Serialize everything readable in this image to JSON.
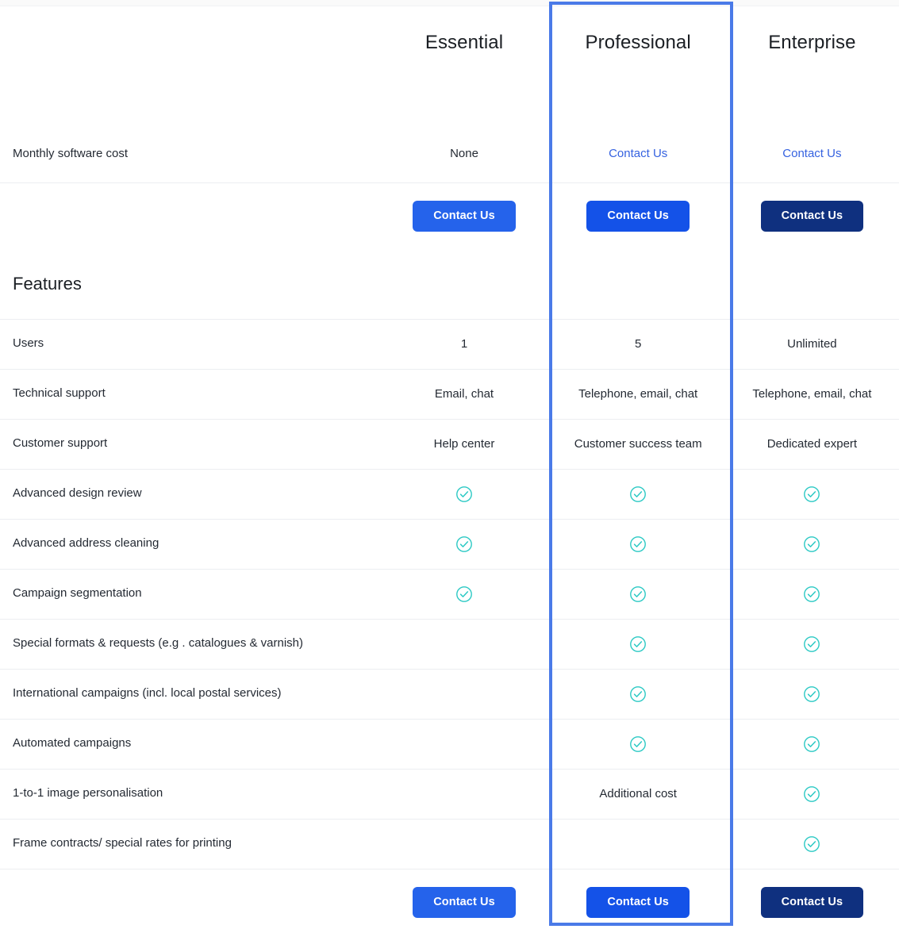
{
  "accent": {
    "highlight_border": "#4a7ae8",
    "link_blue": "#3562e0",
    "check_teal": "#2bc9c4",
    "btn_essential": "#2563eb",
    "btn_professional": "#1452e8",
    "btn_enterprise": "#0f307f"
  },
  "plans": [
    {
      "id": "essential",
      "name": "Essential",
      "highlighted": false
    },
    {
      "id": "professional",
      "name": "Professional",
      "highlighted": true
    },
    {
      "id": "enterprise",
      "name": "Enterprise",
      "highlighted": false
    }
  ],
  "cost_row": {
    "label": "Monthly software cost",
    "values": [
      "None",
      "Contact Us",
      "Contact Us"
    ]
  },
  "cta_top": {
    "labels": [
      "Contact Us",
      "Contact Us",
      "Contact Us"
    ]
  },
  "cta_bottom": {
    "labels": [
      "Contact Us",
      "Contact Us",
      "Contact Us"
    ]
  },
  "features_heading": "Features",
  "features": [
    {
      "label": "Users",
      "values": [
        "1",
        "5",
        "Unlimited"
      ],
      "types": [
        "text",
        "text",
        "text"
      ]
    },
    {
      "label": "Technical support",
      "values": [
        "Email, chat",
        "Telephone, email, chat",
        "Telephone, email, chat"
      ],
      "types": [
        "text",
        "text",
        "text"
      ]
    },
    {
      "label": "Customer support",
      "values": [
        "Help center",
        "Customer success team",
        "Dedicated expert"
      ],
      "types": [
        "text",
        "text",
        "text"
      ]
    },
    {
      "label": "Advanced design review",
      "values": [
        "",
        "",
        ""
      ],
      "types": [
        "check",
        "check",
        "check"
      ]
    },
    {
      "label": "Advanced address cleaning",
      "values": [
        "",
        "",
        ""
      ],
      "types": [
        "check",
        "check",
        "check"
      ]
    },
    {
      "label": "Campaign segmentation",
      "values": [
        "",
        "",
        ""
      ],
      "types": [
        "check",
        "check",
        "check"
      ]
    },
    {
      "label": "Special formats & requests (e.g . catalogues & varnish)",
      "values": [
        "",
        "",
        ""
      ],
      "types": [
        "none",
        "check",
        "check"
      ]
    },
    {
      "label": "International campaigns (incl. local postal services)",
      "values": [
        "",
        "",
        ""
      ],
      "types": [
        "none",
        "check",
        "check"
      ]
    },
    {
      "label": "Automated campaigns",
      "values": [
        "",
        "",
        ""
      ],
      "types": [
        "none",
        "check",
        "check"
      ]
    },
    {
      "label": "1-to-1 image personalisation",
      "values": [
        "",
        "Additional cost",
        ""
      ],
      "types": [
        "none",
        "text",
        "check"
      ]
    },
    {
      "label": "Frame contracts/ special rates for printing",
      "values": [
        "",
        "",
        ""
      ],
      "types": [
        "none",
        "none",
        "check"
      ]
    }
  ],
  "icons": {
    "check": "check-circle-icon"
  }
}
